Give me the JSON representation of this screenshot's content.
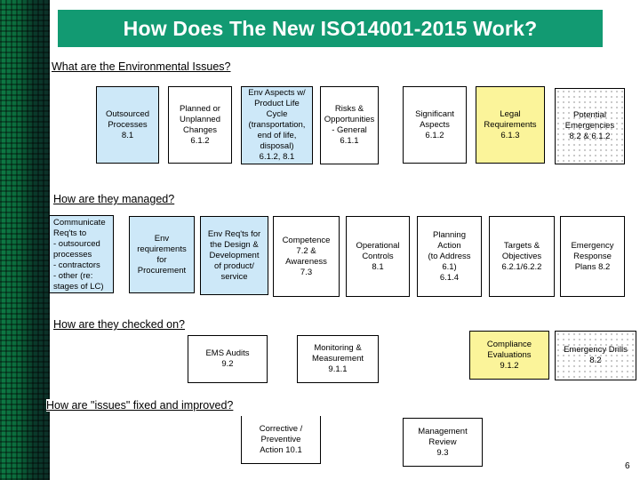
{
  "title": "How Does The New ISO14001-2015  Work?",
  "sections": {
    "issues": {
      "heading": "What are the Environmental Issues?",
      "boxes": [
        {
          "text": "Outsourced\nProcesses\n8.1",
          "fill": "blue"
        },
        {
          "text": "Planned or\nUnplanned\nChanges\n6.1.2",
          "fill": "white"
        },
        {
          "text": "Env Aspects w/\nProduct Life\nCycle\n(transportation,\nend of life,\ndisposal)\n6.1.2, 8.1",
          "fill": "blue"
        },
        {
          "text": "Risks &\nOpportunities\n- General\n6.1.1",
          "fill": "white"
        },
        {
          "text": "Significant\nAspects\n6.1.2",
          "fill": "white"
        },
        {
          "text": "Legal\nRequirements\n6.1.3",
          "fill": "yellow"
        },
        {
          "text": "Potential\nEmergencies\n8.2 & 6.1.2",
          "fill": "dotted"
        }
      ]
    },
    "managed": {
      "heading": "How are they managed?",
      "boxes": [
        {
          "text": "Communicate\nReq'ts to\n- outsourced\nprocesses\n- contractors\n- other (re:\nstages of LC)",
          "fill": "blue"
        },
        {
          "text": "Env\nrequirements\nfor\nProcurement",
          "fill": "blue"
        },
        {
          "text": "Env Req'ts for\nthe Design &\nDevelopment\nof product/\nservice",
          "fill": "blue"
        },
        {
          "text": "Competence\n7.2  &\nAwareness\n7.3",
          "fill": "white"
        },
        {
          "text": "Operational\nControls\n8.1",
          "fill": "white"
        },
        {
          "text": "Planning\nAction\n(to Address\n6.1)\n6.1.4",
          "fill": "white"
        },
        {
          "text": "Targets &\nObjectives\n6.2.1/6.2.2",
          "fill": "white"
        },
        {
          "text": "Emergency\nResponse\nPlans 8.2",
          "fill": "white"
        }
      ]
    },
    "checked": {
      "heading": "How are they checked on?",
      "boxes": [
        {
          "text": "EMS Audits\n9.2",
          "fill": "white"
        },
        {
          "text": "Monitoring &\nMeasurement\n9.1.1",
          "fill": "white"
        },
        {
          "text": "Compliance\nEvaluations\n9.1.2",
          "fill": "yellow"
        },
        {
          "text": "Emergency Drills\n8.2",
          "fill": "dotted"
        }
      ]
    },
    "improved": {
      "heading": "How are \"issues\" fixed and improved?",
      "boxes": [
        {
          "text": "Corrective /\nPreventive\nAction 10.1",
          "fill": "white"
        },
        {
          "text": "Management\nReview\n9.3",
          "fill": "white"
        }
      ]
    }
  },
  "page_number": "6"
}
